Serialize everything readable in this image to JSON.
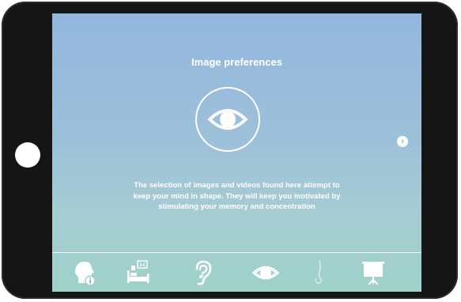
{
  "screen": {
    "title": "Image preferences",
    "description": "The selection of images and videos found here attempt to keep your mind in shape. They will keep you motivated by stimulating your memory and concentration",
    "next_icon": "chevron-right-icon",
    "hero_icon": "eye-icon"
  },
  "tabbar": {
    "tabs": [
      {
        "icon": "head-info-icon",
        "active": false
      },
      {
        "icon": "bed-monitor-icon",
        "active": false
      },
      {
        "icon": "ear-icon",
        "active": false
      },
      {
        "icon": "eye-icon",
        "active": true
      },
      {
        "icon": "nose-icon",
        "active": false
      },
      {
        "icon": "presentation-icon",
        "active": false
      }
    ]
  },
  "colors": {
    "device": "#151515",
    "screen_top": "#93b6de",
    "screen_bottom": "#9fd2c8",
    "text": "#ffffff"
  }
}
